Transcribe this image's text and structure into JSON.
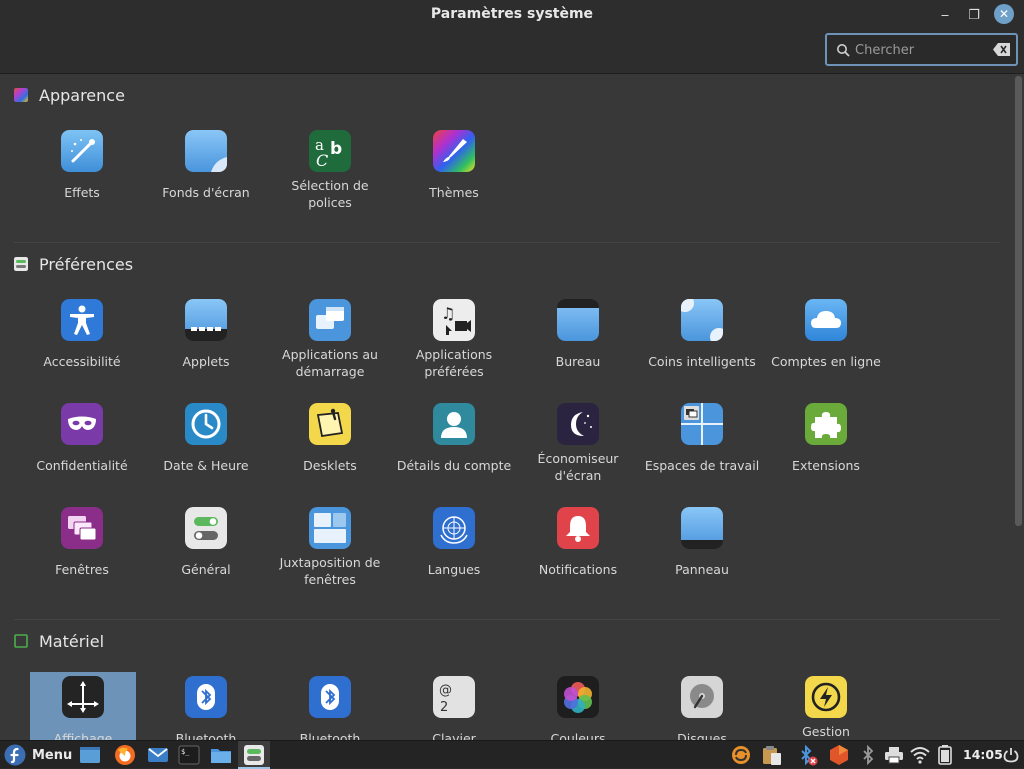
{
  "window": {
    "title": "Paramètres système",
    "minimize_glyph": "‒",
    "maximize_glyph": "❐",
    "close_glyph": "✕"
  },
  "search": {
    "placeholder": "Chercher",
    "value": ""
  },
  "sections": [
    {
      "title": "Apparence",
      "icon": "appearance-icon",
      "items": [
        {
          "label": "Effets",
          "icon": "effects-icon"
        },
        {
          "label": "Fonds d'écran",
          "icon": "wallpaper-icon"
        },
        {
          "label": "Sélection de polices",
          "icon": "fonts-icon"
        },
        {
          "label": "Thèmes",
          "icon": "themes-icon"
        }
      ]
    },
    {
      "title": "Préférences",
      "icon": "preferences-icon",
      "items": [
        {
          "label": "Accessibilité",
          "icon": "accessibility-icon"
        },
        {
          "label": "Applets",
          "icon": "applets-icon"
        },
        {
          "label": "Applications au démarrage",
          "icon": "startup-apps-icon"
        },
        {
          "label": "Applications préférées",
          "icon": "preferred-apps-icon"
        },
        {
          "label": "Bureau",
          "icon": "desktop-icon"
        },
        {
          "label": "Coins intelligents",
          "icon": "hot-corners-icon"
        },
        {
          "label": "Comptes en ligne",
          "icon": "online-accounts-icon"
        },
        {
          "label": "Confidentialité",
          "icon": "privacy-icon"
        },
        {
          "label": "Date & Heure",
          "icon": "clock-icon"
        },
        {
          "label": "Desklets",
          "icon": "desklets-icon"
        },
        {
          "label": "Détails du compte",
          "icon": "account-icon"
        },
        {
          "label": "Économiseur d'écran",
          "icon": "screensaver-icon"
        },
        {
          "label": "Espaces de travail",
          "icon": "workspaces-icon"
        },
        {
          "label": "Extensions",
          "icon": "extensions-icon"
        },
        {
          "label": "Fenêtres",
          "icon": "windows-icon"
        },
        {
          "label": "Général",
          "icon": "general-icon"
        },
        {
          "label": "Juxtaposition de fenêtres",
          "icon": "tiling-icon"
        },
        {
          "label": "Langues",
          "icon": "languages-icon"
        },
        {
          "label": "Notifications",
          "icon": "notifications-icon"
        },
        {
          "label": "Panneau",
          "icon": "panel-icon"
        }
      ]
    },
    {
      "title": "Matériel",
      "icon": "hardware-icon",
      "items": [
        {
          "label": "Affichage",
          "icon": "display-icon",
          "selected": true
        },
        {
          "label": "Bluetooth",
          "icon": "bluetooth-icon"
        },
        {
          "label": "Bluetooth",
          "icon": "bluetooth-icon"
        },
        {
          "label": "Clavier",
          "icon": "keyboard-icon"
        },
        {
          "label": "Couleurs",
          "icon": "colors-icon"
        },
        {
          "label": "Disques",
          "icon": "disks-icon"
        },
        {
          "label": "Gestion",
          "icon": "power-icon"
        }
      ]
    }
  ],
  "taskbar": {
    "menu_label": "Menu",
    "clock": "14:05",
    "apps": [
      "show-desktop-icon",
      "firefox-icon",
      "mail-icon",
      "terminal-icon",
      "files-icon",
      "settings-icon"
    ],
    "tray": [
      "updater-icon",
      "clipboard-icon",
      "bluetooth-off-icon",
      "security-icon",
      "bluetooth-icon",
      "printer-icon",
      "wifi-icon",
      "battery-icon",
      "power-icon"
    ]
  },
  "colors": {
    "accent": "#6d94b8",
    "window_bg": "#383838",
    "titlebar_bg": "#2d2d2d"
  }
}
